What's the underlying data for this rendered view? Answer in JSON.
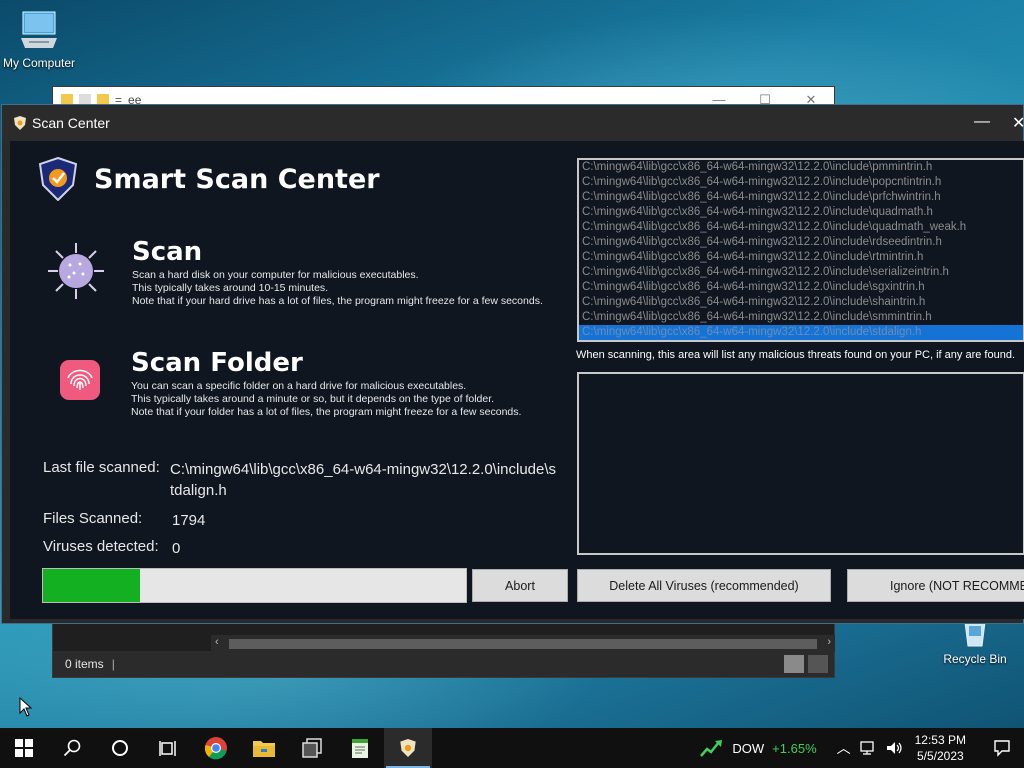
{
  "desktop": {
    "icons": [
      {
        "label": "My Computer"
      },
      {
        "label": "Recycle Bin"
      }
    ]
  },
  "explorer": {
    "title": "ee",
    "controls": {
      "minimize": "—",
      "maximize": "☐",
      "close": "✕"
    },
    "status_items": "0 items"
  },
  "app": {
    "window_title": "Scan Center",
    "controls": {
      "minimize": "—",
      "close": "✕"
    },
    "brand_title": "Smart Scan Center",
    "scan": {
      "heading": "Scan",
      "line1": "Scan a hard disk on your computer for malicious executables.",
      "line2": "This typically takes around 10-15 minutes.",
      "line3": "Note that if your hard drive has a lot of files, the program might freeze for a few seconds."
    },
    "scan_folder": {
      "heading": "Scan Folder",
      "line1": "You can scan a specific folder on a hard drive for malicious executables.",
      "line2": "This typically takes around a minute or so, but it depends on the type of folder.",
      "line3": "Note that if your folder has a lot of files, the program might freeze for a few seconds."
    },
    "stats": {
      "last_file_label": "Last file scanned:",
      "last_file_value": "C:\\mingw64\\lib\\gcc\\x86_64-w64-mingw32\\12.2.0\\include\\stdalign.h",
      "files_label": "Files Scanned:",
      "files_value": "1794",
      "viruses_label": "Viruses detected:",
      "viruses_value": "0"
    },
    "file_list": [
      "C:\\mingw64\\lib\\gcc\\x86_64-w64-mingw32\\12.2.0\\include\\pmmintrin.h",
      "C:\\mingw64\\lib\\gcc\\x86_64-w64-mingw32\\12.2.0\\include\\popcntintrin.h",
      "C:\\mingw64\\lib\\gcc\\x86_64-w64-mingw32\\12.2.0\\include\\prfchwintrin.h",
      "C:\\mingw64\\lib\\gcc\\x86_64-w64-mingw32\\12.2.0\\include\\quadmath.h",
      "C:\\mingw64\\lib\\gcc\\x86_64-w64-mingw32\\12.2.0\\include\\quadmath_weak.h",
      "C:\\mingw64\\lib\\gcc\\x86_64-w64-mingw32\\12.2.0\\include\\rdseedintrin.h",
      "C:\\mingw64\\lib\\gcc\\x86_64-w64-mingw32\\12.2.0\\include\\rtmintrin.h",
      "C:\\mingw64\\lib\\gcc\\x86_64-w64-mingw32\\12.2.0\\include\\serializeintrin.h",
      "C:\\mingw64\\lib\\gcc\\x86_64-w64-mingw32\\12.2.0\\include\\sgxintrin.h",
      "C:\\mingw64\\lib\\gcc\\x86_64-w64-mingw32\\12.2.0\\include\\shaintrin.h",
      "C:\\mingw64\\lib\\gcc\\x86_64-w64-mingw32\\12.2.0\\include\\smmintrin.h",
      "C:\\mingw64\\lib\\gcc\\x86_64-w64-mingw32\\12.2.0\\include\\stdalign.h"
    ],
    "selected_file_index": 11,
    "threats_caption": "When scanning, this area will list any malicious threats found on your PC, if any are found.",
    "progress_fraction": 0.23,
    "buttons": {
      "abort": "Abort",
      "delete_all": "Delete All Viruses (recommended)",
      "ignore": "Ignore (NOT RECOMMENDED)"
    },
    "colors": {
      "progress": "#13b021",
      "selection": "#1673d6"
    }
  },
  "taskbar": {
    "items": [
      "start-icon",
      "search-icon",
      "cortana-icon",
      "task-view-icon",
      "chrome-icon",
      "file-explorer-icon",
      "virtual-box-icon",
      "notepad-icon",
      "scan-center-icon"
    ],
    "stock_name": "DOW",
    "stock_change": "+1.65%",
    "time": "12:53 PM",
    "date": "5/5/2023"
  }
}
